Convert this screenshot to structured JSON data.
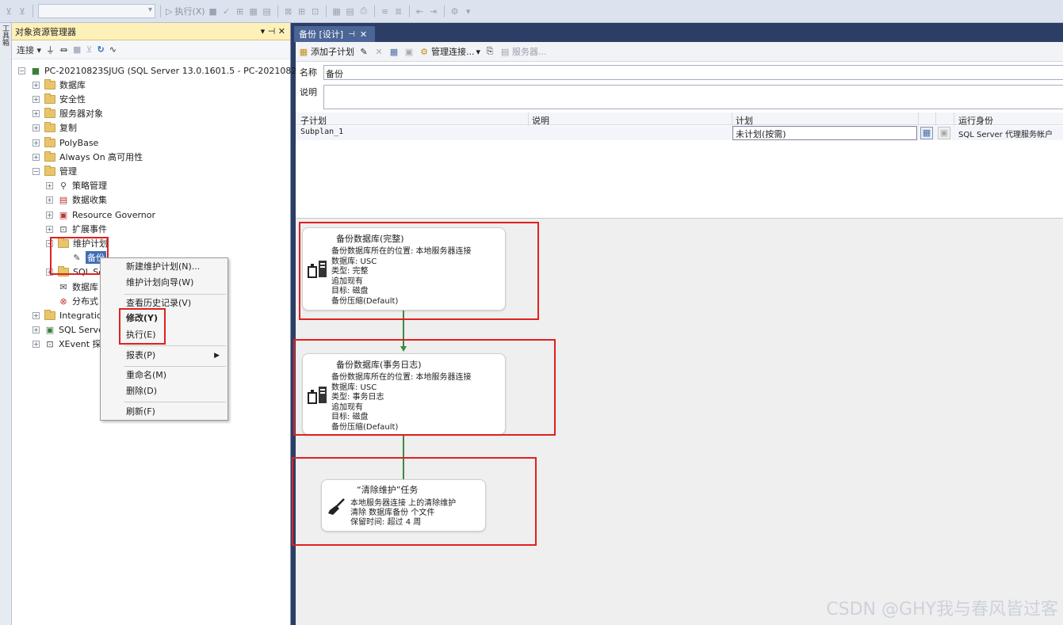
{
  "toolbar": {
    "execute_label": "执行(X)"
  },
  "left_strip": {
    "label": "工具箱"
  },
  "object_explorer": {
    "title": "对象资源管理器",
    "pin_label": "▾ ⊣ ✕",
    "connect_label": "连接",
    "tree": [
      {
        "label": "PC-20210823SJUG (SQL Server 13.0.1601.5 - PC-20210823",
        "icon": "server-icon"
      },
      {
        "label": "数据库"
      },
      {
        "label": "安全性"
      },
      {
        "label": "服务器对象"
      },
      {
        "label": "复制"
      },
      {
        "label": "PolyBase"
      },
      {
        "label": "Always On 高可用性"
      },
      {
        "label": "管理"
      },
      {
        "label": "策略管理"
      },
      {
        "label": "数据收集"
      },
      {
        "label": "Resource Governor"
      },
      {
        "label": "扩展事件"
      },
      {
        "label": "维护计划"
      },
      {
        "label": "备份"
      },
      {
        "label": "SQL Se"
      },
      {
        "label": "数据库"
      },
      {
        "label": "分布式"
      },
      {
        "label": "Integratio"
      },
      {
        "label": "SQL Serve"
      },
      {
        "label": "XEvent 探"
      }
    ]
  },
  "context_menu": {
    "items": [
      "新建维护计划(N)...",
      "维护计划向导(W)",
      "查看历史记录(V)",
      "修改(Y)",
      "执行(E)",
      "报表(P)",
      "重命名(M)",
      "删除(D)",
      "刷新(F)"
    ]
  },
  "designer": {
    "tab_label": "备份 [设计]",
    "toolbar": {
      "add_subplan": "添加子计划",
      "manage_connections": "管理连接...",
      "servers": "服务器..."
    },
    "name_label": "名称",
    "name_value": "备份",
    "desc_label": "说明",
    "grid": {
      "headers": [
        "子计划",
        "说明",
        "计划",
        "运行身份"
      ],
      "row": {
        "subplan": "Subplan_1",
        "description": "",
        "schedule": "未计划(按需)",
        "run_as": "SQL Server 代理服务帐户"
      }
    },
    "tasks": [
      {
        "title": "备份数据库(完整)",
        "lines": [
          "备份数据库所在的位置: 本地服务器连接",
          "数据库: USC",
          "类型: 完整",
          "追加现有",
          "目标: 磁盘",
          "备份压缩(Default)"
        ]
      },
      {
        "title": "备份数据库(事务日志)",
        "lines": [
          "备份数据库所在的位置: 本地服务器连接",
          "数据库: USC",
          "类型: 事务日志",
          "追加现有",
          "目标: 磁盘",
          "备份压缩(Default)"
        ]
      },
      {
        "title": "“清除维护”任务",
        "lines": [
          "本地服务器连接 上的清除维护",
          "清除 数据库备份 个文件",
          "保留时间: 超过 4 周"
        ]
      }
    ]
  },
  "watermark": "CSDN @GHY我与春风皆过客",
  "colors": {
    "highlight": "#e02020",
    "precedence_arrow": "#3f8a3f",
    "selection": "#3f6fb5",
    "panel_title": "#fdf0b8"
  }
}
